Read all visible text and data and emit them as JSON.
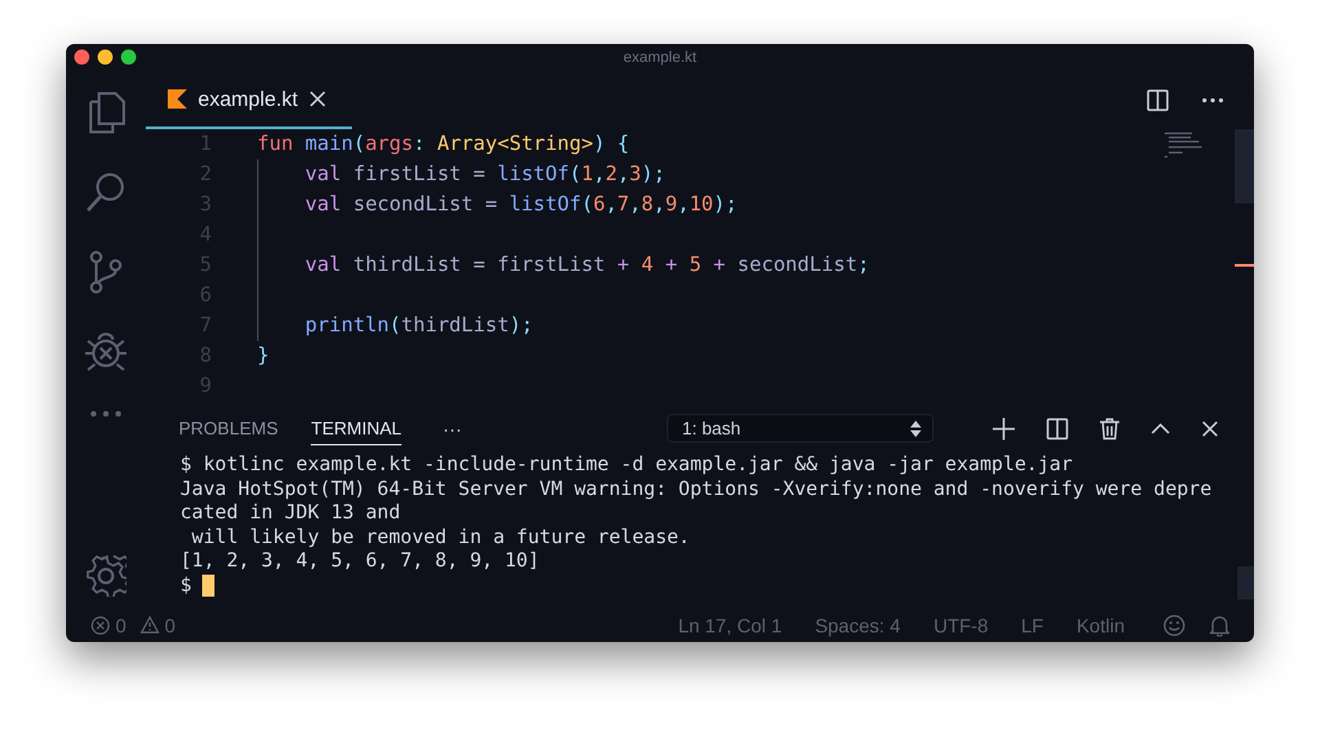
{
  "window": {
    "title": "example.kt"
  },
  "editor_tabs": [
    {
      "label": "example.kt",
      "selected": true
    }
  ],
  "code": [
    {
      "number": "1",
      "indented": false,
      "tokens": [
        {
          "kind": "keyword2",
          "text": "fun "
        },
        {
          "kind": "func",
          "text": "main"
        },
        {
          "kind": "punct",
          "text": "("
        },
        {
          "kind": "param",
          "text": "args"
        },
        {
          "kind": "punct",
          "text": ": "
        },
        {
          "kind": "type",
          "text": "Array<String>"
        },
        {
          "kind": "punct",
          "text": ") {"
        }
      ]
    },
    {
      "number": "2",
      "indented": true,
      "tokens": [
        {
          "kind": "keyword",
          "text": "val"
        },
        {
          "kind": "plain",
          "text": " firstList = "
        },
        {
          "kind": "func",
          "text": "listOf"
        },
        {
          "kind": "punct",
          "text": "("
        },
        {
          "kind": "num",
          "text": "1"
        },
        {
          "kind": "punct",
          "text": ","
        },
        {
          "kind": "num",
          "text": "2"
        },
        {
          "kind": "punct",
          "text": ","
        },
        {
          "kind": "num",
          "text": "3"
        },
        {
          "kind": "punct",
          "text": ");"
        }
      ]
    },
    {
      "number": "3",
      "indented": true,
      "tokens": [
        {
          "kind": "keyword",
          "text": "val"
        },
        {
          "kind": "plain",
          "text": " secondList = "
        },
        {
          "kind": "func",
          "text": "listOf"
        },
        {
          "kind": "punct",
          "text": "("
        },
        {
          "kind": "num",
          "text": "6"
        },
        {
          "kind": "punct",
          "text": ","
        },
        {
          "kind": "num",
          "text": "7"
        },
        {
          "kind": "punct",
          "text": ","
        },
        {
          "kind": "num",
          "text": "8"
        },
        {
          "kind": "punct",
          "text": ","
        },
        {
          "kind": "num",
          "text": "9"
        },
        {
          "kind": "punct",
          "text": ","
        },
        {
          "kind": "num",
          "text": "10"
        },
        {
          "kind": "punct",
          "text": ");"
        }
      ]
    },
    {
      "number": "4",
      "indented": true
    },
    {
      "number": "5",
      "indented": true,
      "tokens": [
        {
          "kind": "keyword",
          "text": "val"
        },
        {
          "kind": "plain",
          "text": " thirdList = firstList "
        },
        {
          "kind": "op",
          "text": "+ "
        },
        {
          "kind": "num",
          "text": "4"
        },
        {
          "kind": "op",
          "text": " + "
        },
        {
          "kind": "num",
          "text": "5"
        },
        {
          "kind": "op",
          "text": " + "
        },
        {
          "kind": "plain",
          "text": "secondList"
        },
        {
          "kind": "punct",
          "text": ";"
        }
      ]
    },
    {
      "number": "6",
      "indented": true
    },
    {
      "number": "7",
      "indented": true,
      "tokens": [
        {
          "kind": "func",
          "text": "println"
        },
        {
          "kind": "punct",
          "text": "("
        },
        {
          "kind": "plain",
          "text": "thirdList"
        },
        {
          "kind": "punct",
          "text": ");"
        }
      ]
    },
    {
      "number": "8",
      "indented": false,
      "tokens": [
        {
          "kind": "punct",
          "text": "}"
        }
      ]
    },
    {
      "number": "9",
      "indented": false
    }
  ],
  "panel_tabs": [
    {
      "label": "PROBLEMS",
      "selected": false
    },
    {
      "label": "TERMINAL",
      "selected": true
    }
  ],
  "panel_more": "···",
  "terminal_select": "1: bash",
  "terminal_lines": [
    "$ kotlinc example.kt -include-runtime -d example.jar && java -jar example.jar",
    "Java HotSpot(TM) 64-Bit Server VM warning: Options -Xverify:none and -noverify were depre",
    "cated in JDK 13 and",
    " will likely be removed in a future release.",
    "[1, 2, 3, 4, 5, 6, 7, 8, 9, 10]"
  ],
  "prompt": "$",
  "status_bar": {
    "errors": "0",
    "warnings": "0",
    "items": [
      "Ln 17, Col 1",
      "Spaces: 4",
      "UTF-8",
      "LF",
      "Kotlin"
    ]
  }
}
